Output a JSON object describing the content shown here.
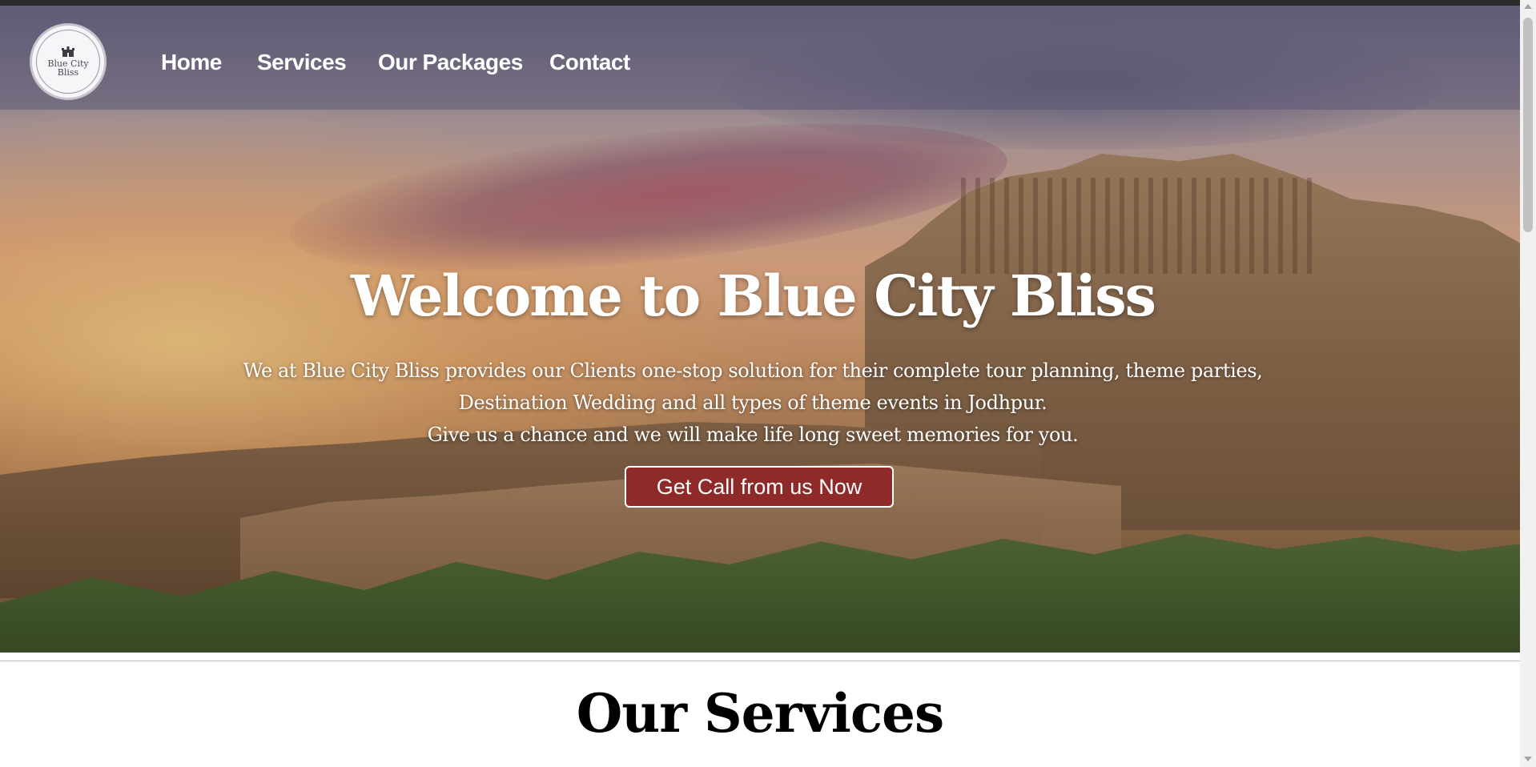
{
  "brand": {
    "logo_text": "Blue City Bliss",
    "logo_icon": "fort-icon"
  },
  "nav": {
    "items": [
      {
        "label": "Home"
      },
      {
        "label": "Services"
      },
      {
        "label": "Our Packages"
      },
      {
        "label": "Contact"
      }
    ]
  },
  "hero": {
    "title": "Welcome to Blue City Bliss",
    "description_line1": "We at Blue City Bliss provides our Clients one-stop solution for their complete tour planning, theme parties, Destination Wedding and all types of theme events in Jodhpur.",
    "description_line2": "Give us a chance and we will make life long sweet memories for you.",
    "cta_label": "Get Call from us Now"
  },
  "services": {
    "heading": "Our Services"
  },
  "colors": {
    "cta_background": "#8f2a2a",
    "nav_text": "#ffffff",
    "heading_text": "#000000"
  }
}
